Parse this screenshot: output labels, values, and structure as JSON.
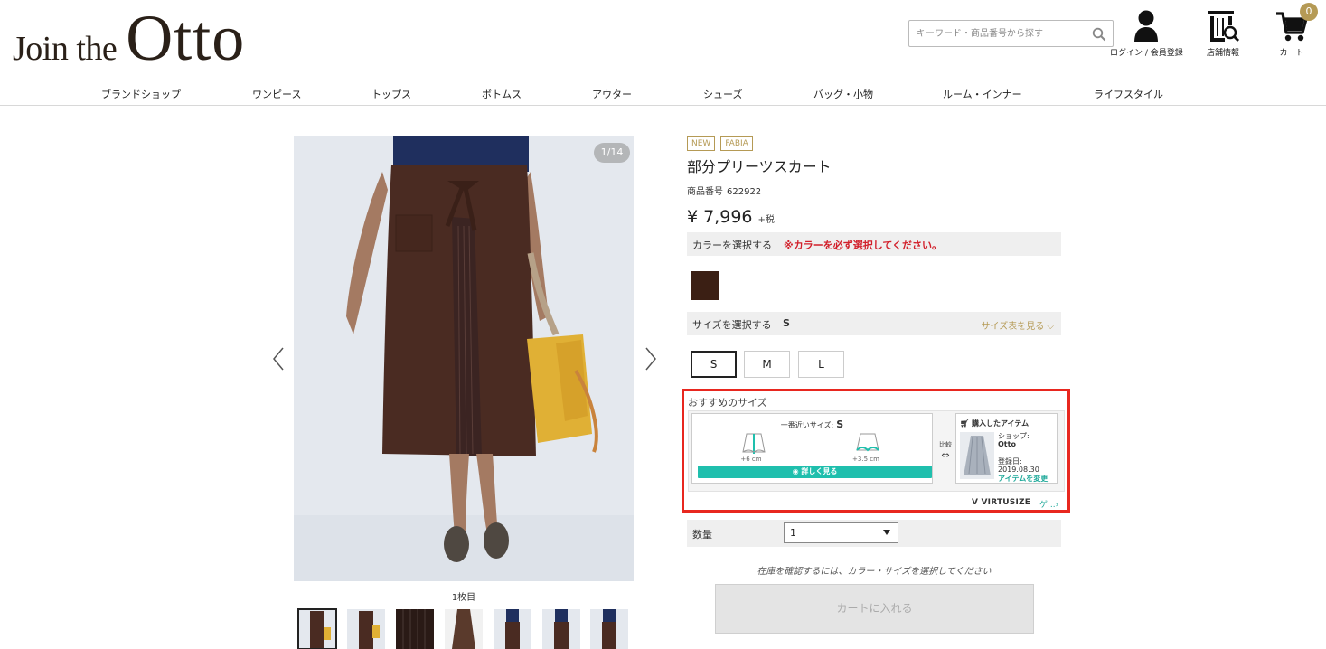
{
  "logo": {
    "join": "Join the",
    "otto": "Otto"
  },
  "search": {
    "placeholder": "キーワード・商品番号から探す",
    "icon": "search-icon"
  },
  "header_icons": {
    "login": "ログイン / 会員登録",
    "store": "店舗情報",
    "cart": "カート",
    "cart_count": "0"
  },
  "nav": [
    "ブランドショップ",
    "ワンピース",
    "トップス",
    "ボトムス",
    "アウター",
    "シューズ",
    "バッグ・小物",
    "ルーム・インナー",
    "ライフスタイル"
  ],
  "gallery": {
    "counter": "1/14",
    "caption": "1枚目",
    "thumb_count": 7,
    "selected_thumb": 1
  },
  "product": {
    "tags": [
      "NEW",
      "FABIA"
    ],
    "title": "部分プリーツスカート",
    "number_label": "商品番号",
    "number": "622922",
    "price": "¥ 7,996",
    "tax": "+税"
  },
  "color": {
    "label": "カラーを選択する",
    "required": "※カラーを必ず選択してください。",
    "swatch_color": "#3b1f14"
  },
  "size": {
    "label": "サイズを選択する",
    "selected": "S",
    "chart_link": "サイズ表を見る",
    "options": [
      "S",
      "M",
      "L"
    ]
  },
  "recommend": {
    "title": "おすすめのサイズ",
    "nearest_label": "一番近いサイズ:",
    "nearest_size": "S",
    "diff_a": "+6 cm",
    "diff_b": "+3.5 cm",
    "detail_button": "詳しく見る",
    "compare": "比較",
    "purchased_title": "購入したアイテム",
    "shop_label": "ショップ:",
    "shop": "Otto",
    "reg_label": "登録日:",
    "reg_date": "2019.08.30",
    "change_item": "アイテムを変更",
    "brand": "VIRTUSIZE",
    "more": "ゲ..."
  },
  "quantity": {
    "label": "数量",
    "value": "1"
  },
  "stock_note": "在庫を確認するには、カラー・サイズを選択してください",
  "cart_button": "カートに入れる"
}
